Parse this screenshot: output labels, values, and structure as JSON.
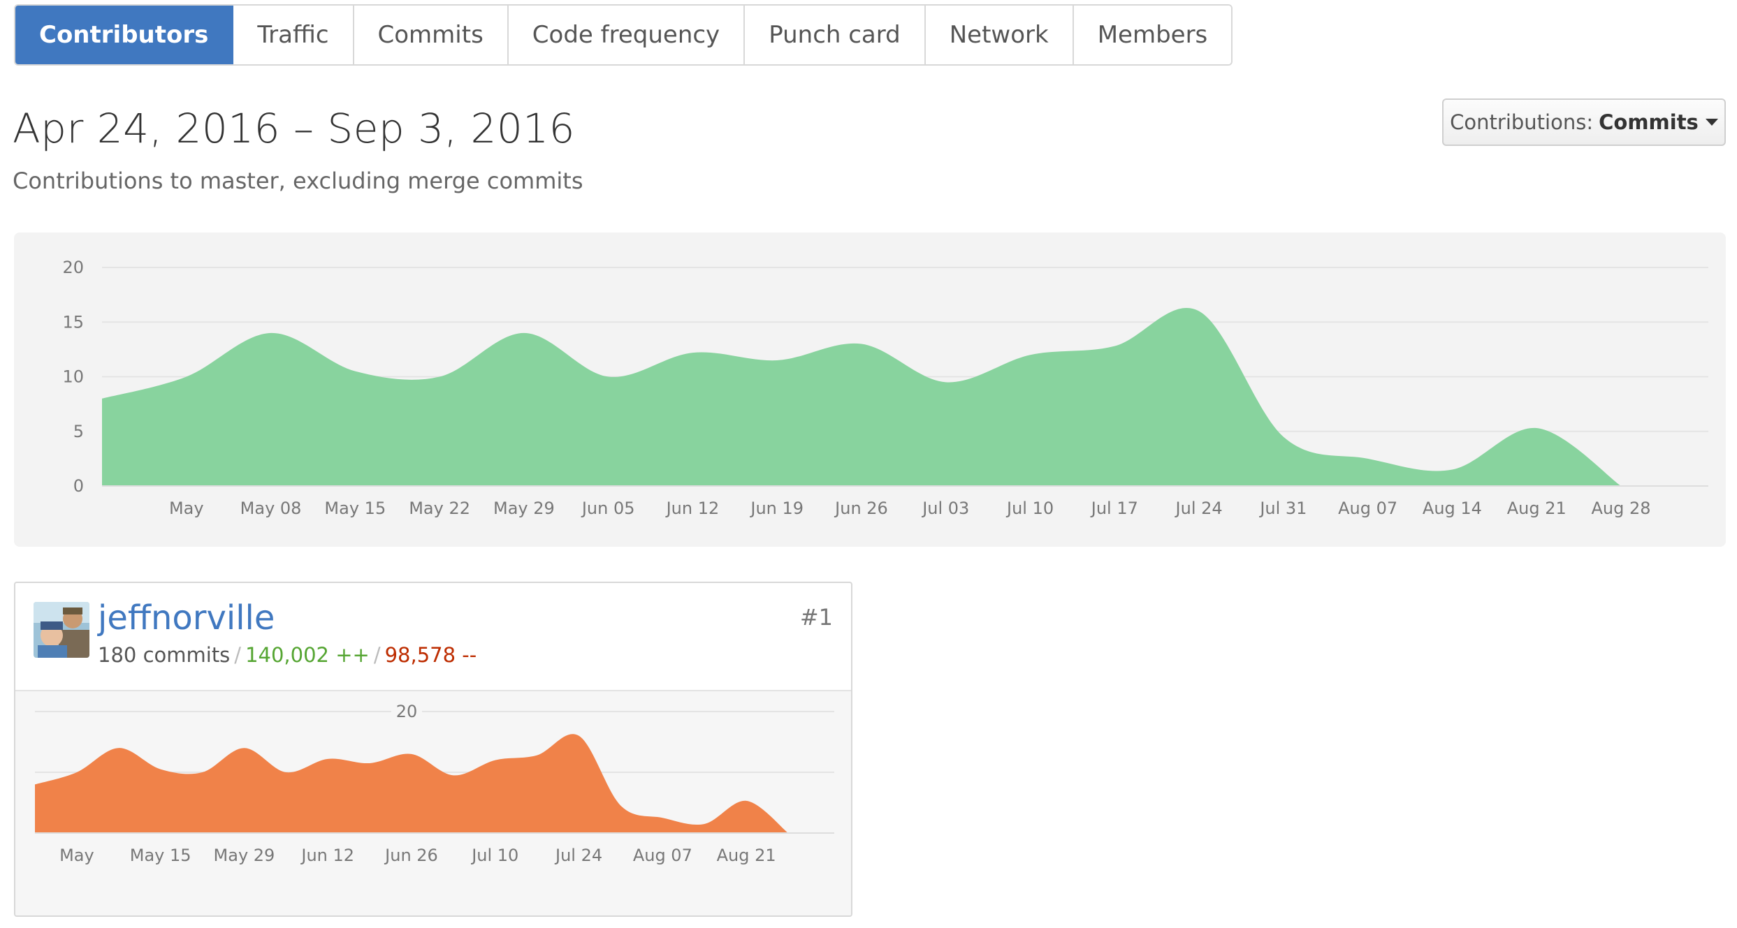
{
  "tabs": [
    {
      "label": "Contributors",
      "selected": true
    },
    {
      "label": "Traffic",
      "selected": false
    },
    {
      "label": "Commits",
      "selected": false
    },
    {
      "label": "Code frequency",
      "selected": false
    },
    {
      "label": "Punch card",
      "selected": false
    },
    {
      "label": "Network",
      "selected": false
    },
    {
      "label": "Members",
      "selected": false
    }
  ],
  "header": {
    "range_title": "Apr 24, 2016 – Sep 3, 2016",
    "subtitle": "Contributions to master, excluding merge commits"
  },
  "contributions_select": {
    "label": "Contributions:",
    "value": "Commits"
  },
  "colors": {
    "accent": "#4078c0",
    "main_area": "#88d39e",
    "contributor_area": "#f08249",
    "additions": "#55a532",
    "deletions": "#bd2c00"
  },
  "contributor": {
    "username": "jeffnorville",
    "rank": "#1",
    "commits": "180 commits",
    "additions": "140,002 ++",
    "deletions": "98,578 --",
    "separator": "/"
  },
  "chart_data": [
    {
      "type": "area",
      "x": [
        "2016-04-24",
        "2016-05-01",
        "2016-05-08",
        "2016-05-15",
        "2016-05-22",
        "2016-05-29",
        "2016-06-05",
        "2016-06-12",
        "2016-06-19",
        "2016-06-26",
        "2016-07-03",
        "2016-07-10",
        "2016-07-17",
        "2016-07-24",
        "2016-07-31",
        "2016-08-07",
        "2016-08-14",
        "2016-08-21",
        "2016-08-28"
      ],
      "values": [
        8,
        10,
        14,
        10.5,
        10,
        14,
        10,
        12.2,
        11.5,
        13,
        9.5,
        12,
        12.8,
        16,
        4.5,
        2.5,
        1.5,
        5.3,
        0
      ],
      "x_tick_labels": [
        "May",
        "May 08",
        "May 15",
        "May 22",
        "May 29",
        "Jun 05",
        "Jun 12",
        "Jun 19",
        "Jun 26",
        "Jul 03",
        "Jul 10",
        "Jul 17",
        "Jul 24",
        "Jul 31",
        "Aug 07",
        "Aug 14",
        "Aug 21",
        "Aug 28"
      ],
      "y_ticks": [
        0,
        5,
        10,
        15,
        20
      ],
      "ylim": [
        0,
        20
      ],
      "grid": true
    },
    {
      "type": "area",
      "x": [
        "2016-04-24",
        "2016-05-01",
        "2016-05-08",
        "2016-05-15",
        "2016-05-22",
        "2016-05-29",
        "2016-06-05",
        "2016-06-12",
        "2016-06-19",
        "2016-06-26",
        "2016-07-03",
        "2016-07-10",
        "2016-07-17",
        "2016-07-24",
        "2016-07-31",
        "2016-08-07",
        "2016-08-14",
        "2016-08-21",
        "2016-08-28"
      ],
      "values": [
        8,
        10,
        14,
        10.5,
        10,
        14,
        10,
        12.2,
        11.5,
        13,
        9.5,
        12,
        12.8,
        16,
        4.5,
        2.5,
        1.5,
        5.3,
        0
      ],
      "x_tick_labels": [
        "May",
        "May 15",
        "May 29",
        "Jun 12",
        "Jun 26",
        "Jul 10",
        "Jul 24",
        "Aug 07",
        "Aug 21"
      ],
      "y_ticks": [
        20
      ],
      "ylim": [
        0,
        20
      ],
      "grid": true
    }
  ]
}
